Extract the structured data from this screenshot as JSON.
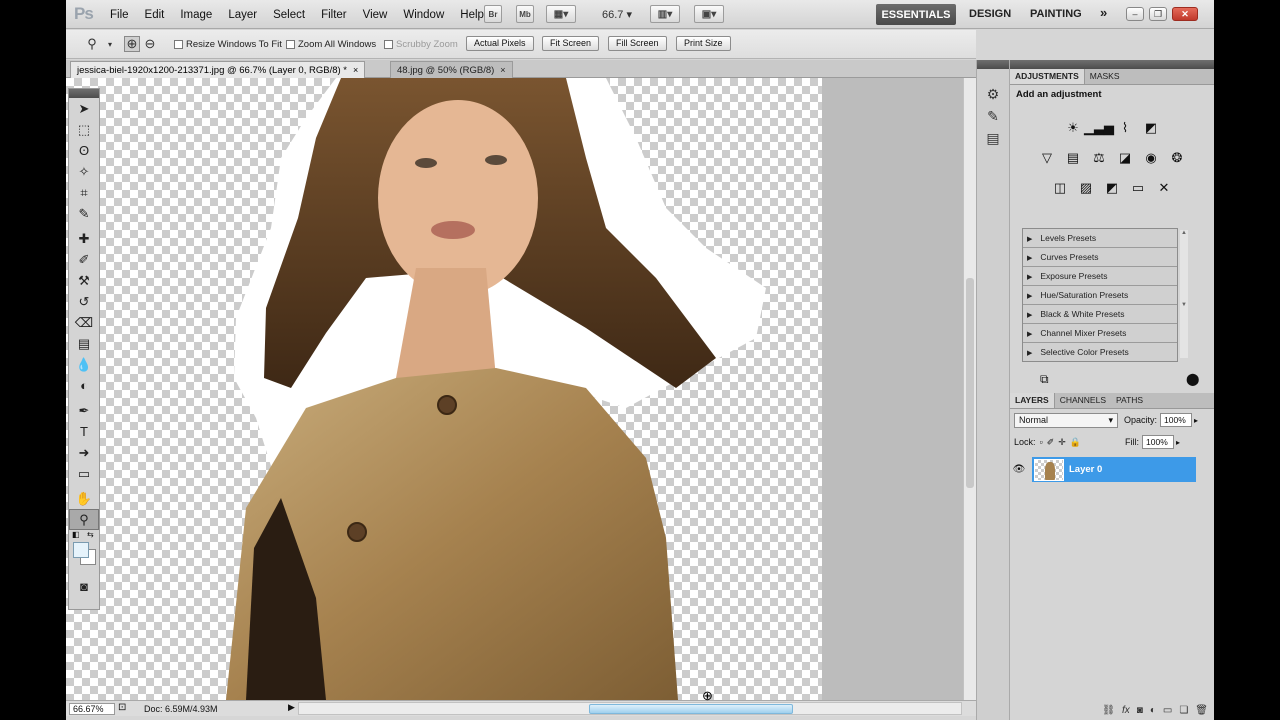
{
  "app": {
    "logo": "Ps"
  },
  "menu": [
    "File",
    "Edit",
    "Image",
    "Layer",
    "Select",
    "Filter",
    "View",
    "Window",
    "Help"
  ],
  "appbar": {
    "bridge_label": "Br",
    "minibridge_label": "Mb",
    "zoom_level": "66.7",
    "workspaces": {
      "active": "ESSENTIALS",
      "design": "DESIGN",
      "painting": "PAINTING",
      "more": "»"
    }
  },
  "window_controls": {
    "minimize": "–",
    "restore": "❐",
    "close": "✕"
  },
  "options": {
    "resize_windows": "Resize Windows To Fit",
    "zoom_all": "Zoom All Windows",
    "scrubby": "Scrubby Zoom",
    "actual_pixels": "Actual Pixels",
    "fit_screen": "Fit Screen",
    "fill_screen": "Fill Screen",
    "print_size": "Print Size"
  },
  "doc_tabs": [
    {
      "label": "jessica-biel-1920x1200-213371.jpg @ 66.7% (Layer 0, RGB/8) *",
      "close": "×"
    },
    {
      "label": "48.jpg @ 50% (RGB/8)",
      "close": "×"
    }
  ],
  "status": {
    "zoom": "66.67%",
    "doc": "Doc: 6.59M/4.93M"
  },
  "adjustments": {
    "tab_active": "ADJUSTMENTS",
    "tab_masks": "MASKS",
    "title": "Add an adjustment",
    "presets": [
      "Levels Presets",
      "Curves Presets",
      "Exposure Presets",
      "Hue/Saturation Presets",
      "Black & White Presets",
      "Channel Mixer Presets",
      "Selective Color Presets"
    ]
  },
  "layers": {
    "tabs": [
      "LAYERS",
      "CHANNELS",
      "PATHS"
    ],
    "blend_mode": "Normal",
    "opacity_label": "Opacity:",
    "opacity_value": "100%",
    "lock_label": "Lock:",
    "fill_label": "Fill:",
    "fill_value": "100%",
    "layer_name": "Layer 0"
  },
  "colors": {
    "selection_blue": "#3d9ae8",
    "essentials_bg": "#4a4a4a",
    "close_red": "#c0392b",
    "coat": "#a6824f"
  }
}
